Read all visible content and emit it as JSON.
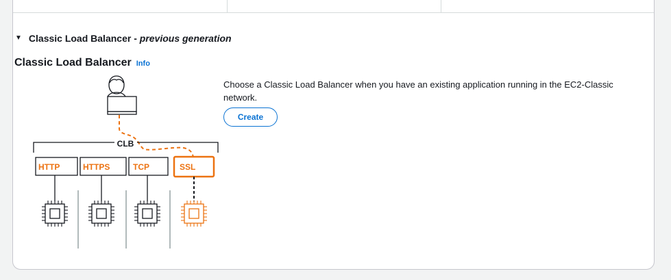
{
  "section": {
    "caret": "▼",
    "title_prefix": "Classic Load Balancer - ",
    "title_suffix": "previous generation"
  },
  "card": {
    "title": "Classic Load Balancer",
    "info_label": "Info",
    "description": "Choose a Classic Load Balancer when you have an existing application running in the EC2-Classic network.",
    "create_label": "Create"
  },
  "diagram": {
    "lb_label": "CLB",
    "protocols": [
      {
        "label": "HTTP",
        "highlighted": false
      },
      {
        "label": "HTTPS",
        "highlighted": false
      },
      {
        "label": "TCP",
        "highlighted": false
      },
      {
        "label": "SSL",
        "highlighted": true
      }
    ],
    "colors": {
      "accent": "#ec7211",
      "line": "#16191f",
      "link": "#0972d3"
    },
    "icons": [
      "user-at-laptop-icon",
      "chip-icon"
    ]
  }
}
